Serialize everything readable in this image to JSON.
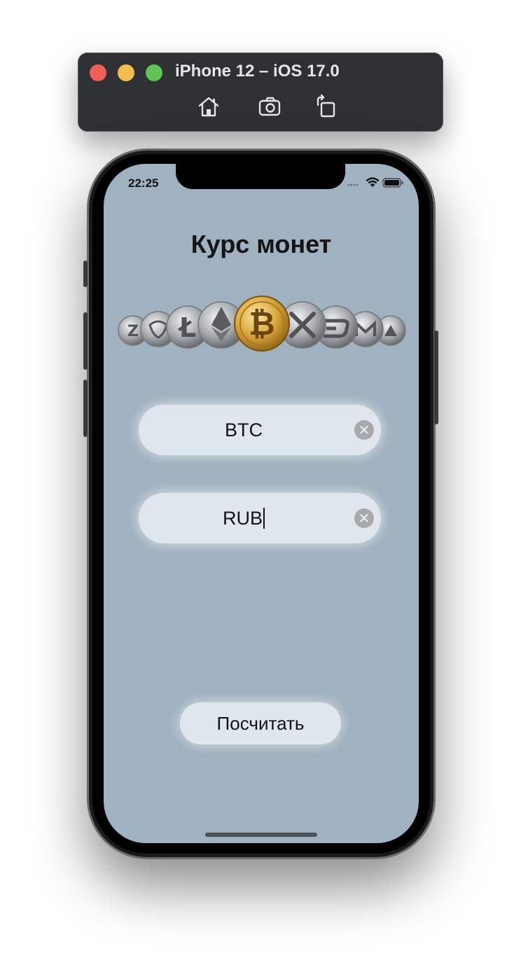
{
  "simulator": {
    "title": "iPhone 12 – iOS 17.0",
    "toolbar_icons": [
      "home-icon",
      "screenshot-icon",
      "rotate-icon"
    ]
  },
  "status_bar": {
    "time": "22:25",
    "icons": [
      "signal-dots-icon",
      "wifi-icon",
      "battery-icon"
    ]
  },
  "app": {
    "title": "Курс монет",
    "banner_icon": "crypto-coins-image",
    "from_field": {
      "value": "BTC",
      "clear_icon": "clear-icon"
    },
    "to_field": {
      "value": "RUB",
      "clear_icon": "clear-icon"
    },
    "calculate_label": "Посчитать"
  },
  "colors": {
    "screen_background": "#a0b1bf",
    "field_background": "#e0e6ed",
    "bitcoin_gold": "#d9a53a",
    "silver_coin": "#9ea2a6"
  }
}
